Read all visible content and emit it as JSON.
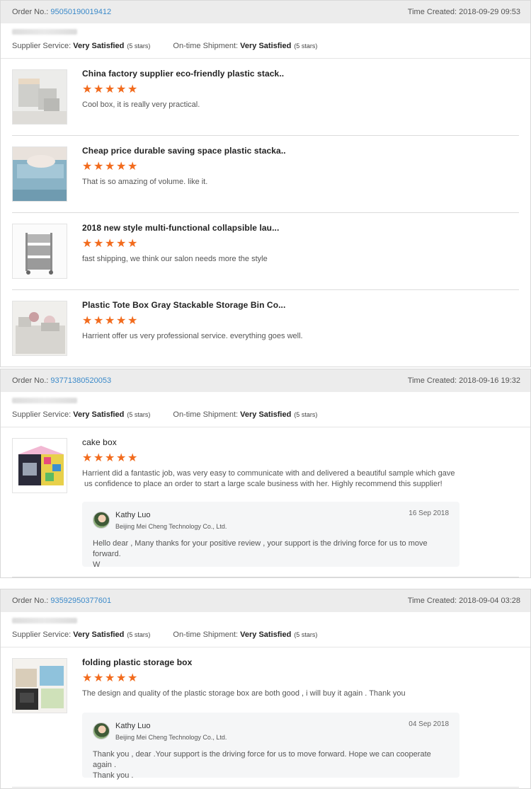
{
  "labels": {
    "order_no": "Order No.:",
    "time_created": "Time Created:",
    "supplier_service": "Supplier Service:",
    "ontime_shipment": "On-time Shipment:"
  },
  "colors": {
    "star": "#f26b1d",
    "order_link": "#3a89c9"
  },
  "orders": [
    {
      "order_no": "95050190019412",
      "time_created": "2018-09-29 09:53",
      "supplier_service": "Very Satisfied",
      "supplier_stars": "(5 stars)",
      "shipment": "Very Satisfied",
      "shipment_stars": "(5 stars)",
      "items": [
        {
          "title": "China factory supplier eco-friendly plastic stack..",
          "rating": 5,
          "comment": "Cool box, it is really very practical."
        },
        {
          "title": "Cheap price durable saving space plastic stacka..",
          "rating": 5,
          "comment": "That is so amazing of volume. like it."
        },
        {
          "title": "2018 new style multi-functional collapsible lau...",
          "rating": 5,
          "comment": "fast shipping, we think our salon needs more the style"
        },
        {
          "title": "Plastic Tote Box Gray Stackable Storage Bin Co...",
          "rating": 5,
          "comment": "Harrient offer us very professional service. everything goes well."
        }
      ]
    },
    {
      "order_no": "93771380520053",
      "time_created": "2018-09-16 19:32",
      "supplier_service": "Very Satisfied",
      "supplier_stars": "(5 stars)",
      "shipment": "Very Satisfied",
      "shipment_stars": "(5 stars)",
      "items": [
        {
          "title": "cake box",
          "rating": 5,
          "comment_line1": "Harrient did a fantastic job, was very easy to communicate with and delivered a beautiful sample which gave",
          "comment_line2": " us confidence to place an order to start a large scale business with her. Highly recommend this supplier!",
          "reply": {
            "name": "Kathy Luo",
            "company": "Beijing Mei Cheng Technology Co., Ltd.",
            "date": "16 Sep 2018",
            "line1": "Hello dear , Many thanks for your positive review , your support is the driving force for us to move forward.",
            "line2": "W"
          }
        }
      ]
    },
    {
      "order_no": "93592950377601",
      "time_created": "2018-09-04 03:28",
      "supplier_service": "Very Satisfied",
      "supplier_stars": "(5 stars)",
      "shipment": "Very Satisfied",
      "shipment_stars": "(5 stars)",
      "items": [
        {
          "title": "folding plastic storage box",
          "rating": 5,
          "comment": "The design and quality of the plastic storage box are both good , i will buy it again . Thank you",
          "reply": {
            "name": "Kathy Luo",
            "company": "Beijing Mei Cheng Technology Co., Ltd.",
            "date": "04 Sep 2018",
            "line1": "Thank you , dear .Your support is the driving force for us to move forward. Hope we can cooperate again .",
            "line2": "Thank you ."
          }
        }
      ]
    }
  ]
}
